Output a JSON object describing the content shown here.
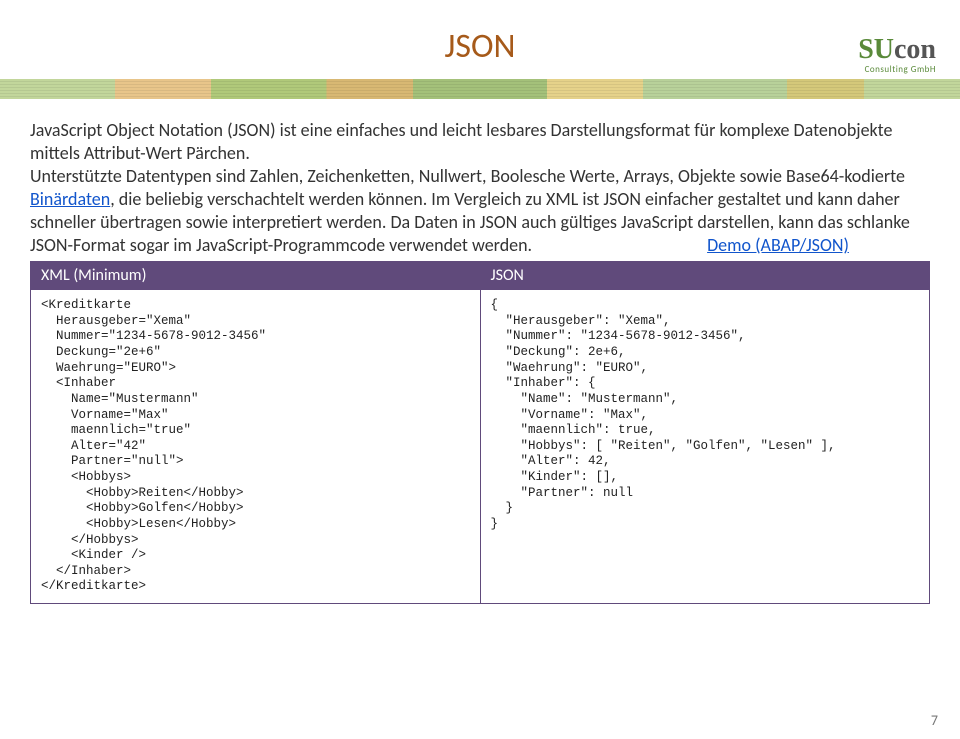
{
  "logo": {
    "part1": "SU",
    "part2": "con",
    "subtitle": "Consulting GmbH"
  },
  "title": "JSON",
  "paragraph1": "JavaScript Object Notation (JSON) ist eine einfaches und leicht lesbares Darstellungsformat für komplexe Datenobjekte mittels Attribut-Wert Pärchen.",
  "paragraph2_pre": "Unterstützte Datentypen sind Zahlen, Zeichenketten, Nullwert, Boolesche Werte, Arrays, Objekte sowie Base64-kodierte ",
  "paragraph2_link": "Binärdaten",
  "paragraph2_post": ", die beliebig verschachtelt werden können. Im Vergleich zu XML ist JSON einfacher gestaltet und kann daher schneller übertragen sowie interpretiert werden. Da Daten in JSON auch gültiges JavaScript darstellen, kann das schlanke JSON-Format sogar im JavaScript-Programmcode verwendet werden.",
  "demo_link": "Demo (ABAP/JSON)",
  "table": {
    "header_left": "XML (Minimum)",
    "header_right": "JSON",
    "cell_left": "<Kreditkarte\n  Herausgeber=\"Xema\"\n  Nummer=\"1234-5678-9012-3456\"\n  Deckung=\"2e+6\"\n  Waehrung=\"EURO\">\n  <Inhaber\n    Name=\"Mustermann\"\n    Vorname=\"Max\"\n    maennlich=\"true\"\n    Alter=\"42\"\n    Partner=\"null\">\n    <Hobbys>\n      <Hobby>Reiten</Hobby>\n      <Hobby>Golfen</Hobby>\n      <Hobby>Lesen</Hobby>\n    </Hobbys>\n    <Kinder />\n  </Inhaber>\n</Kreditkarte>",
    "cell_right": "{\n  \"Herausgeber\": \"Xema\",\n  \"Nummer\": \"1234-5678-9012-3456\",\n  \"Deckung\": 2e+6,\n  \"Waehrung\": \"EURO\",\n  \"Inhaber\": {\n    \"Name\": \"Mustermann\",\n    \"Vorname\": \"Max\",\n    \"maennlich\": true,\n    \"Hobbys\": [ \"Reiten\", \"Golfen\", \"Lesen\" ],\n    \"Alter\": 42,\n    \"Kinder\": [],\n    \"Partner\": null\n  }\n}"
  },
  "page_number": "7"
}
